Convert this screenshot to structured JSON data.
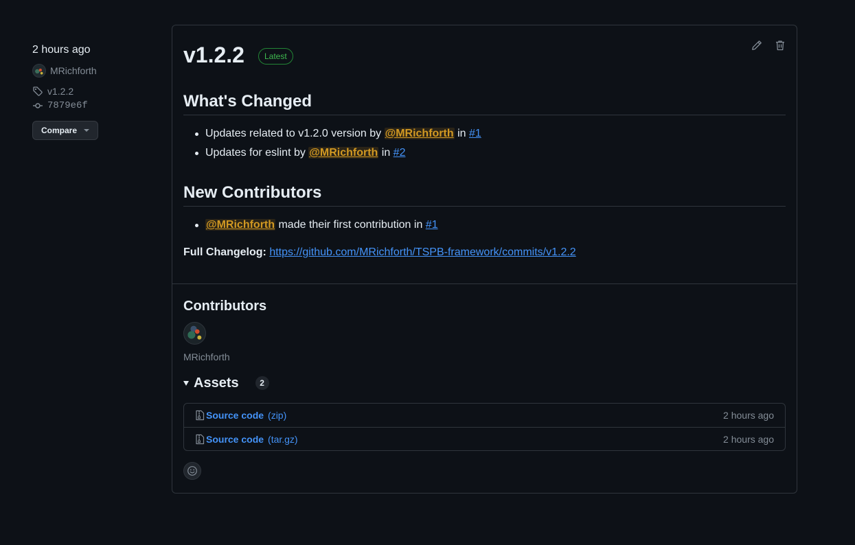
{
  "meta": {
    "time": "2 hours ago",
    "author": "MRichforth",
    "tag": "v1.2.2",
    "commit": "7879e6f",
    "compare_label": "Compare"
  },
  "release": {
    "title": "v1.2.2",
    "badge": "Latest",
    "whats_changed_heading": "What's Changed",
    "changes": [
      {
        "text": "Updates related to v1.2.0 version by ",
        "mention": "@MRichforth",
        "in": " in ",
        "pr": "#1"
      },
      {
        "text": "Updates for eslint by ",
        "mention": "@MRichforth",
        "in": " in ",
        "pr": "#2"
      }
    ],
    "new_contributors_heading": "New Contributors",
    "new_contributors": [
      {
        "mention": "@MRichforth",
        "text": " made their first contribution in ",
        "pr": "#1"
      }
    ],
    "changelog_label": "Full Changelog:",
    "changelog_url": "https://github.com/MRichforth/TSPB-framework/commits/v1.2.2"
  },
  "contributors": {
    "heading": "Contributors",
    "names": [
      "MRichforth"
    ]
  },
  "assets": {
    "heading": "Assets",
    "count": "2",
    "items": [
      {
        "label": "Source code",
        "ext": "(zip)",
        "time": "2 hours ago",
        "icon": "zip-file-icon"
      },
      {
        "label": "Source code",
        "ext": "(tar.gz)",
        "time": "2 hours ago",
        "icon": "zip-file-icon"
      }
    ]
  },
  "colors": {
    "background": "#0d1117",
    "accent_link": "#4493f8",
    "latest_green": "#3fb950",
    "mention": "#d29922",
    "border": "#30363d"
  },
  "icons": {
    "edit": "pencil-icon",
    "delete": "trash-icon",
    "tag": "tag-icon",
    "commit": "git-commit-icon",
    "reaction": "smiley-icon"
  }
}
